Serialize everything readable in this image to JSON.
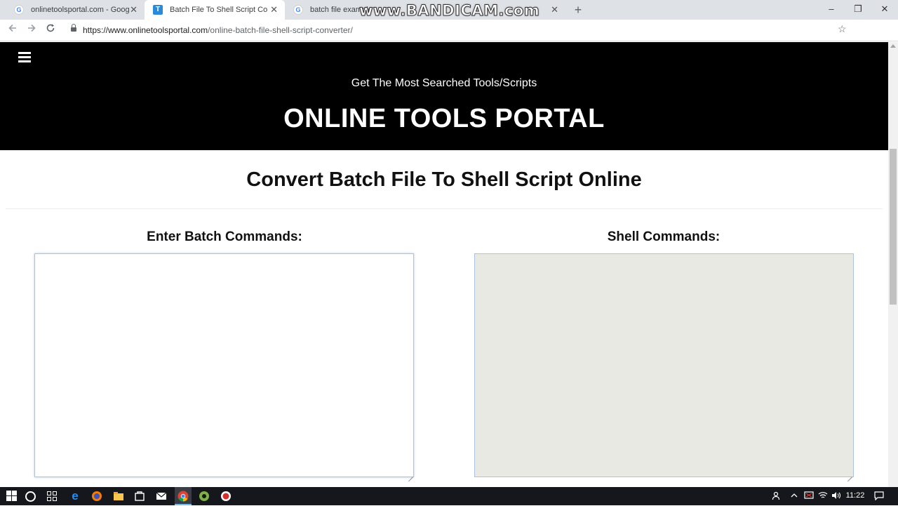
{
  "browser": {
    "tabs": [
      {
        "title": "onlinetoolsportal.com - Google S",
        "favicon": "google-favicon",
        "active": false
      },
      {
        "title": "Batch File To Shell Script Convert",
        "favicon": "T",
        "active": true
      },
      {
        "title": "batch file example",
        "favicon": "google-favicon",
        "active": false
      }
    ],
    "new_tab_symbol": "+",
    "watermark": "www.BANDICAM.com",
    "window_controls": {
      "minimize": "–",
      "maximize": "❐",
      "close": "✕"
    },
    "url_host": "https://www.onlinetoolsportal.com",
    "url_path": "/online-batch-file-shell-script-converter/",
    "tab_close_symbol": "✕"
  },
  "site": {
    "tagline": "Get The Most Searched Tools/Scripts",
    "brand": "ONLINE TOOLS PORTAL",
    "page_title": "Convert Batch File To Shell Script Online",
    "input_label": "Enter Batch Commands:",
    "output_label": "Shell Commands:",
    "input_value": "",
    "output_value": ""
  },
  "taskbar": {
    "clock": "11:22",
    "pinned": [
      "edge-icon",
      "firefox-icon",
      "file-explorer-icon",
      "store-icon",
      "mail-icon",
      "chrome-icon",
      "android-studio-icon",
      "bandicam-icon"
    ]
  },
  "colors": {
    "header_bg": "#000000",
    "output_bg": "#e8e9e2",
    "textbox_border": "#a8c3e6",
    "tab_strip": "#dee1e6",
    "taskbar": "#16171c"
  }
}
